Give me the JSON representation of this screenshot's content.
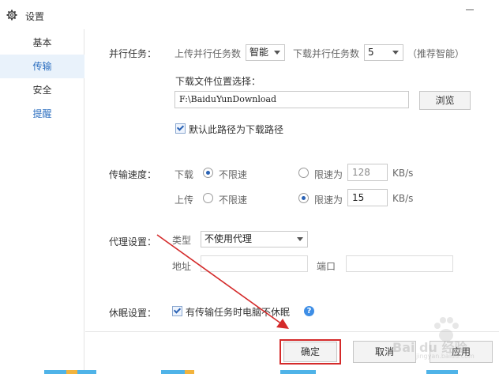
{
  "window": {
    "title": "设置"
  },
  "sidebar": {
    "items": [
      {
        "label": "基本"
      },
      {
        "label": "传输"
      },
      {
        "label": "安全"
      },
      {
        "label": "提醒"
      }
    ]
  },
  "parallel": {
    "label": "并行任务：",
    "upload_label": "上传并行任务数",
    "upload_value": "智能",
    "download_label": "下载并行任务数",
    "download_value": "5",
    "hint": "（推荐智能）"
  },
  "location": {
    "label": "下载文件位置选择：",
    "path_value": "F:\\BaiduYunDownload",
    "browse_label": "浏览",
    "default_checkbox_label": "默认此路径为下载路径",
    "default_checked": true
  },
  "speed": {
    "label": "传输速度：",
    "download_label": "下载",
    "upload_label": "上传",
    "unlimited_label": "不限速",
    "limit_label": "限速为",
    "download_limit_value": "128",
    "upload_limit_value": "15",
    "unit": "KB/s",
    "download_mode": "unlimited",
    "upload_mode": "limited"
  },
  "proxy": {
    "label": "代理设置：",
    "type_label": "类型",
    "type_value": "不使用代理",
    "address_label": "地址",
    "port_label": "端口"
  },
  "sleep": {
    "label": "休眠设置：",
    "checkbox_label": "有传输任务时电脑不休眠",
    "checked": true
  },
  "footer": {
    "ok_label": "确定",
    "cancel_label": "取消",
    "apply_label": "应用"
  },
  "colors": {
    "accent": "#2b6ebf",
    "highlight": "#d42a2a",
    "arrow": "#d42a2a"
  },
  "watermark": {
    "text": "Bai du 经验",
    "sub": "jingyan.baidu.com"
  }
}
